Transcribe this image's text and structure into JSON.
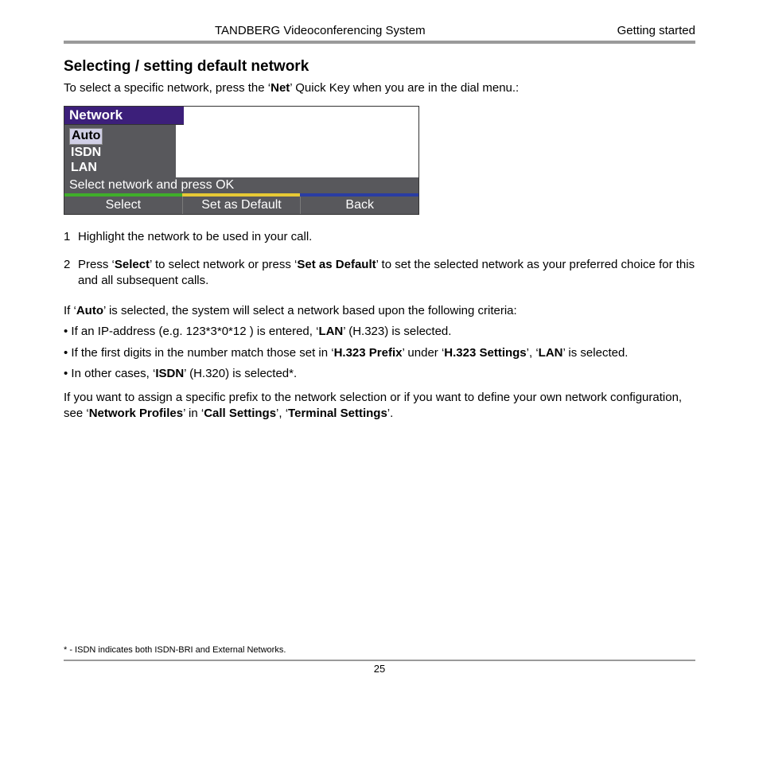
{
  "header": {
    "title": "TANDBERG Videoconferencing System",
    "section": "Getting started"
  },
  "heading": "Selecting / setting default network",
  "intro": {
    "pre": "To select a specific network, press the ‘",
    "key": "Net",
    "post": "’ Quick Key when you are in the dial menu.:"
  },
  "panel": {
    "title": "Network",
    "items": [
      "Auto",
      "ISDN",
      "LAN"
    ],
    "hint": "Select network and press OK",
    "buttons": [
      "Select",
      "Set as Default",
      "Back"
    ]
  },
  "steps": {
    "s1": "Highlight the network to be used in your call.",
    "s2_pre": "Press ‘",
    "s2_b1": "Select",
    "s2_mid": "’ to select network or press ‘",
    "s2_b2": "Set as Default",
    "s2_post": "’ to set the selected network as your preferred choice for this and all subsequent calls."
  },
  "auto": {
    "lead_pre": "If ‘",
    "lead_b": "Auto",
    "lead_post": "’ is selected, the system will select a network based upon the following criteria:",
    "b1_pre": "• If an IP-address (e.g. 123*3*0*12 ) is entered, ‘",
    "b1_b": "LAN",
    "b1_post": "’ (H.323) is selected.",
    "b2_pre": "• If the first digits in the number match those set in ‘",
    "b2_b1": "H.323 Prefix",
    "b2_mid": "’ under ‘",
    "b2_b2": "H.323 Settings",
    "b2_mid2": "’, ‘",
    "b2_b3": "LAN",
    "b2_post": "’ is selected.",
    "b3_pre": "• In other cases, ‘",
    "b3_b": "ISDN",
    "b3_post": "’ (H.320) is selected*."
  },
  "tail": {
    "pre": "If you want to assign a specific prefix to the network selection or if you want to define your own network configuration, see ‘",
    "b1": "Network Profiles",
    "mid1": "’ in ‘",
    "b2": "Call Settings",
    "mid2": "’, ‘",
    "b3": "Terminal Settings",
    "post": "’."
  },
  "footnote": "* - ISDN indicates both ISDN-BRI and External Networks.",
  "pagenum": "25"
}
